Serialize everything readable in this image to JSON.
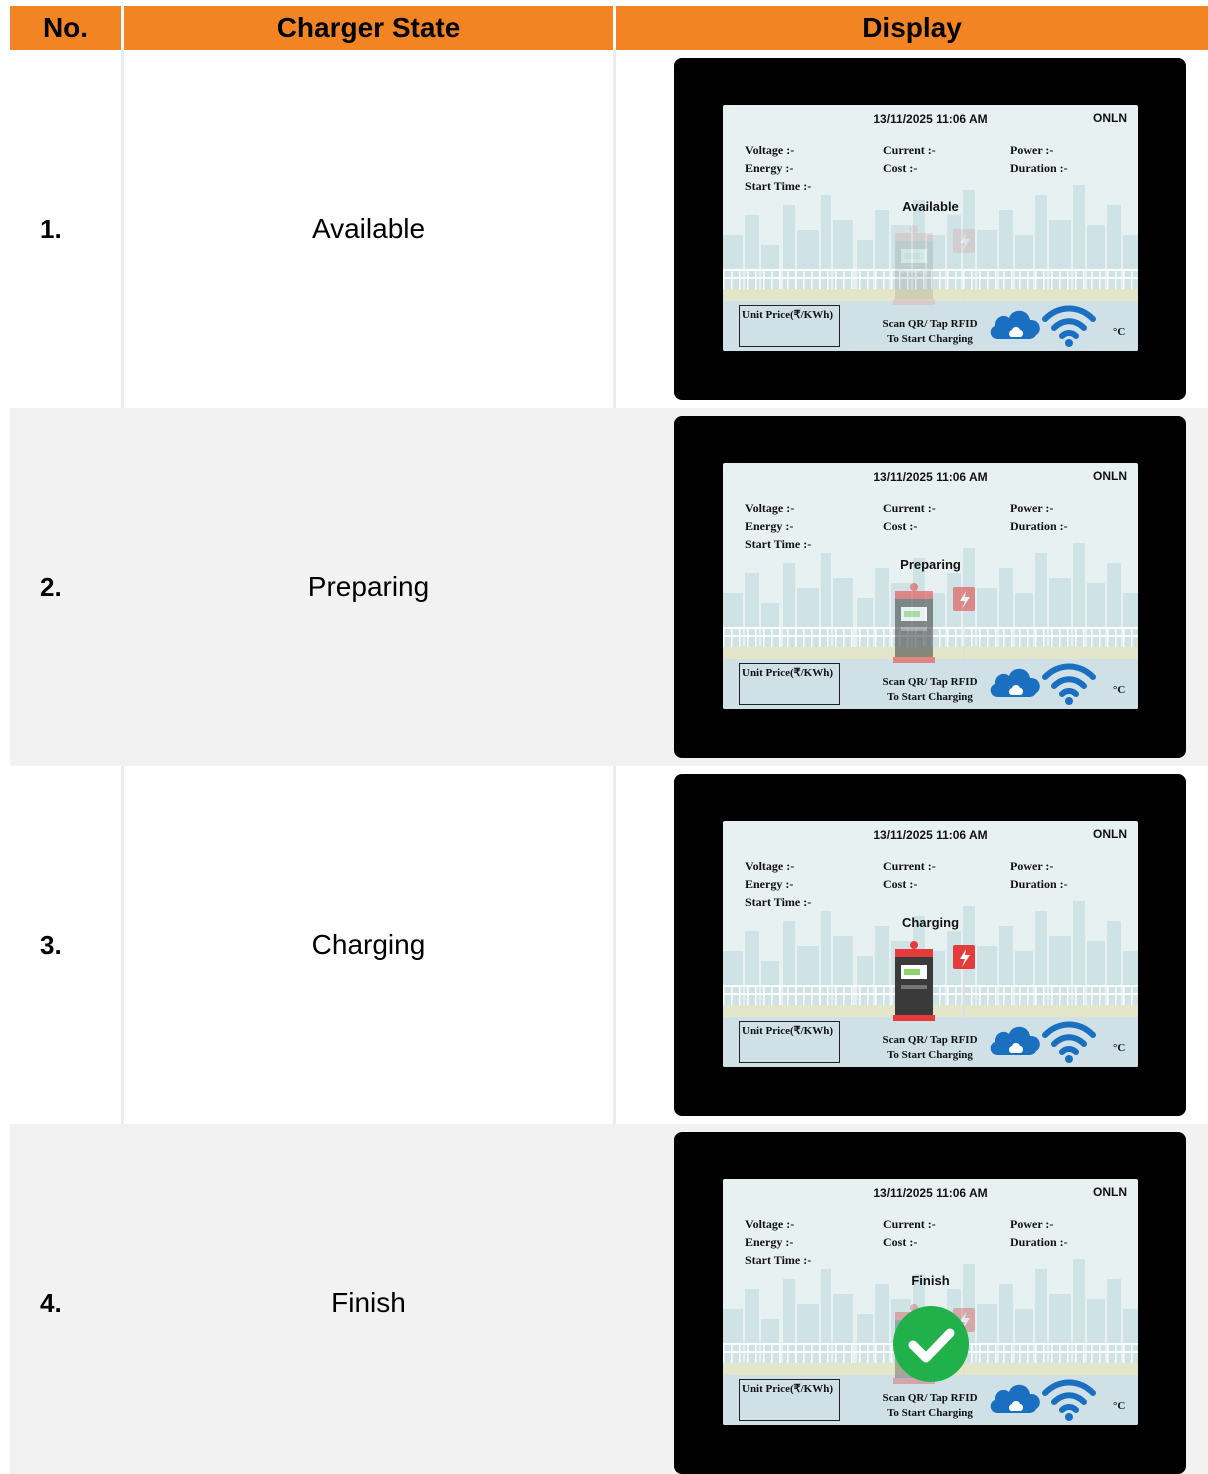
{
  "columns": {
    "no": "No.",
    "state": "Charger State",
    "display": "Display"
  },
  "screen": {
    "datetime": "13/11/2025 11:06 AM",
    "connection": "ONLN",
    "voltage": "Voltage :-",
    "current": "Current :-",
    "power": "Power :-",
    "energy": "Energy :-",
    "cost": "Cost :-",
    "duration": "Duration :-",
    "start_time": "Start Time :-",
    "unit_price": "Unit Price(₹/KWh)",
    "scan_line1": "Scan QR/ Tap RFID",
    "scan_line2": "To Start Charging",
    "temp_unit": "°C"
  },
  "rows": [
    {
      "no": "1.",
      "state": "Available",
      "display_status": "Available",
      "icon": "charger-faded-icon"
    },
    {
      "no": "2.",
      "state": "Preparing",
      "display_status": "Preparing",
      "icon": "charger-dim-icon"
    },
    {
      "no": "3.",
      "state": "Charging",
      "display_status": "Charging",
      "icon": "charger-active-icon"
    },
    {
      "no": "4.",
      "state": "Finish",
      "display_status": "Finish",
      "icon": "checkmark-circle-icon"
    }
  ],
  "colors": {
    "header": "#f28424",
    "charger_red": "#e53b3b",
    "check_green": "#21b14b",
    "cloud_wifi_blue": "#1a6fc0"
  }
}
